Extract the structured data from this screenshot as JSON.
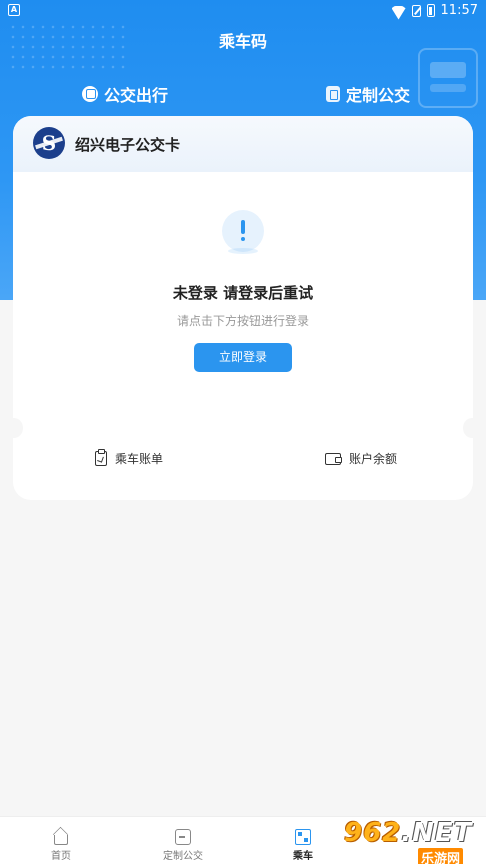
{
  "status_bar": {
    "time": "11:57",
    "app_badge": "A"
  },
  "header": {
    "title": "乘车码"
  },
  "tabs": [
    {
      "label": "公交出行",
      "icon": "bus-icon"
    },
    {
      "label": "定制公交",
      "icon": "custom-bus-icon"
    }
  ],
  "card": {
    "name": "绍兴电子公交卡",
    "logo_letter": "S",
    "message_title": "未登录 请登录后重试",
    "message_sub": "请点击下方按钮进行登录",
    "login_button": "立即登录",
    "actions": [
      {
        "label": "乘车账单",
        "icon": "bill-icon"
      },
      {
        "label": "账户余额",
        "icon": "wallet-icon"
      }
    ]
  },
  "bottom_nav": [
    {
      "label": "首页",
      "icon": "home-icon"
    },
    {
      "label": "定制公交",
      "icon": "chat-icon"
    },
    {
      "label": "乘车",
      "icon": "qr-code-icon",
      "active": true
    }
  ],
  "watermark": {
    "number": "962",
    "suffix": ".NET",
    "subtitle": "乐游网"
  },
  "colors": {
    "primary": "#2b95ef",
    "header_gradient_top": "#1f8df0",
    "background": "#f6f6f6"
  }
}
